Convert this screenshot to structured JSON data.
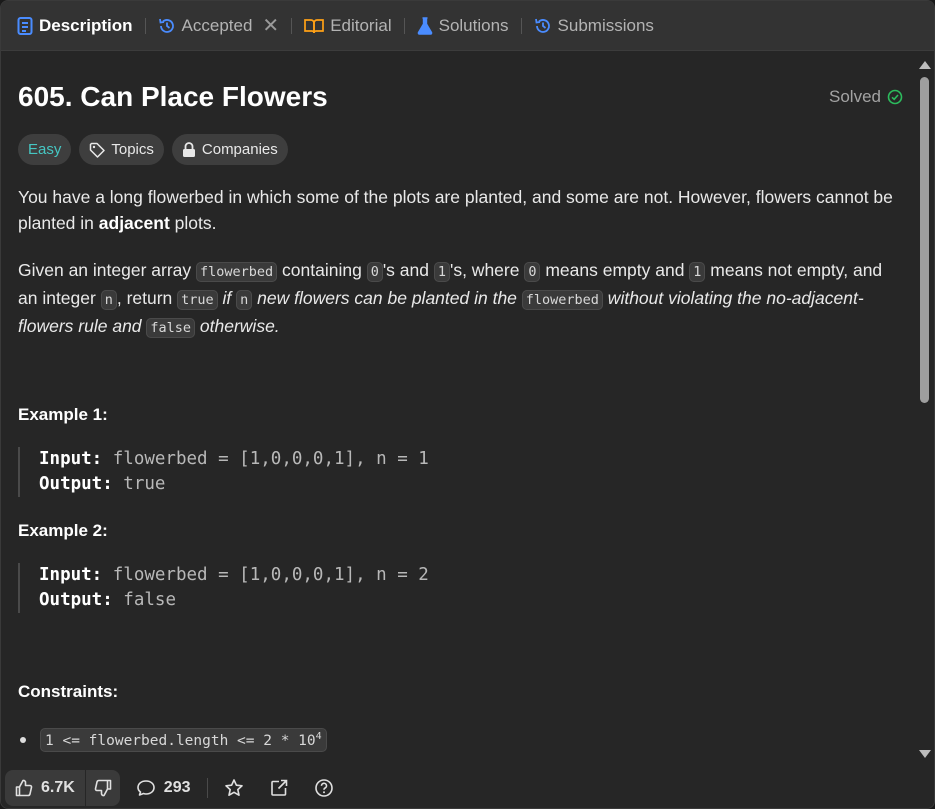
{
  "tabs": [
    {
      "label": "Description",
      "icon": "description-icon",
      "active": true
    },
    {
      "label": "Accepted",
      "icon": "history-icon"
    },
    {
      "label": "Editorial",
      "icon": "book-icon"
    },
    {
      "label": "Solutions",
      "icon": "flask-icon"
    },
    {
      "label": "Submissions",
      "icon": "history-icon"
    }
  ],
  "problem": {
    "title": "605. Can Place Flowers",
    "status": "Solved",
    "difficulty": "Easy",
    "topics_label": "Topics",
    "companies_label": "Companies"
  },
  "description": {
    "p1_a": "You have a long flowerbed in which some of the plots are planted, and some are not. However, flowers cannot be planted in ",
    "p1_b": "adjacent",
    "p1_c": " plots.",
    "p2": {
      "t1": "Given an integer array ",
      "c1": "flowerbed",
      "t2": " containing ",
      "c2": "0",
      "t3": "'s and ",
      "c3": "1",
      "t4": "'s, where ",
      "c4": "0",
      "t5": " means empty and ",
      "c5": "1",
      "t6": " means not empty, and an integer ",
      "c6": "n",
      "t7": ", return ",
      "c7": "true",
      "i1": " if ",
      "c8": "n",
      "i2": " new flowers can be planted in the ",
      "c9": "flowerbed",
      "i3": " without violating the no-adjacent-flowers rule and ",
      "c10": "false",
      "i4": " otherwise."
    }
  },
  "examples": [
    {
      "title": "Example 1:",
      "input_label": "Input:",
      "input": " flowerbed = [1,0,0,0,1], n = 1",
      "output_label": "Output:",
      "output": " true"
    },
    {
      "title": "Example 2:",
      "input_label": "Input:",
      "input": " flowerbed = [1,0,0,0,1], n = 2",
      "output_label": "Output:",
      "output": " false"
    }
  ],
  "constraints": {
    "title": "Constraints:",
    "item_text": "1 <= flowerbed.length <= 2 * 10",
    "item_sup": "4"
  },
  "footer": {
    "likes": "6.7K",
    "comments": "293"
  },
  "colors": {
    "accent_easy": "#46c6c2",
    "solved_check": "#2cbb5d",
    "tab_icon_blue": "#4a8cff",
    "editorial_orange": "#ffa116"
  }
}
